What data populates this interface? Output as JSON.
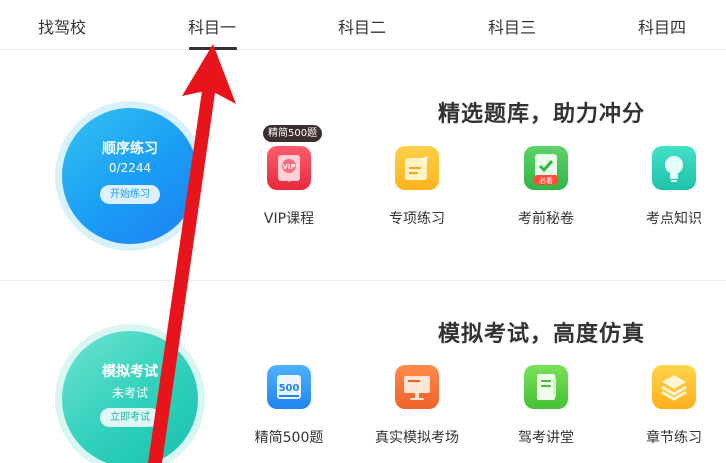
{
  "tabs": [
    {
      "label": "找驾校"
    },
    {
      "label": "科目一"
    },
    {
      "label": "科目二"
    },
    {
      "label": "科目三"
    },
    {
      "label": "科目四"
    }
  ],
  "active_tab": "科目一",
  "section1": {
    "title": "精选题库，助力冲分",
    "circle": {
      "title": "顺序练习",
      "progress": "0/2244",
      "button": "开始练习"
    },
    "badge": "精简500题",
    "items": [
      {
        "label": "VIP课程",
        "icon": "vip-icon"
      },
      {
        "label": "专项练习",
        "icon": "edit-note-icon"
      },
      {
        "label": "考前秘卷",
        "icon": "must-see-check-icon"
      },
      {
        "label": "考点知识",
        "icon": "lightbulb-icon"
      }
    ],
    "vip_icon_text": "VIP",
    "must_see_text": "必看"
  },
  "section2": {
    "title": "模拟考试，高度仿真",
    "circle": {
      "title": "模拟考试",
      "status": "未考试",
      "button": "立即考试"
    },
    "items": [
      {
        "label": "精简500题",
        "icon": "book-500-icon"
      },
      {
        "label": "真实模拟考场",
        "icon": "monitor-icon"
      },
      {
        "label": "驾考讲堂",
        "icon": "lecture-book-icon"
      },
      {
        "label": "章节练习",
        "icon": "layers-icon"
      }
    ],
    "book_icon_text": "500"
  },
  "colors": {
    "blue_circle": "#1a9cf5",
    "teal_circle": "#2fd0bc",
    "annotation_arrow": "#e8141b"
  }
}
